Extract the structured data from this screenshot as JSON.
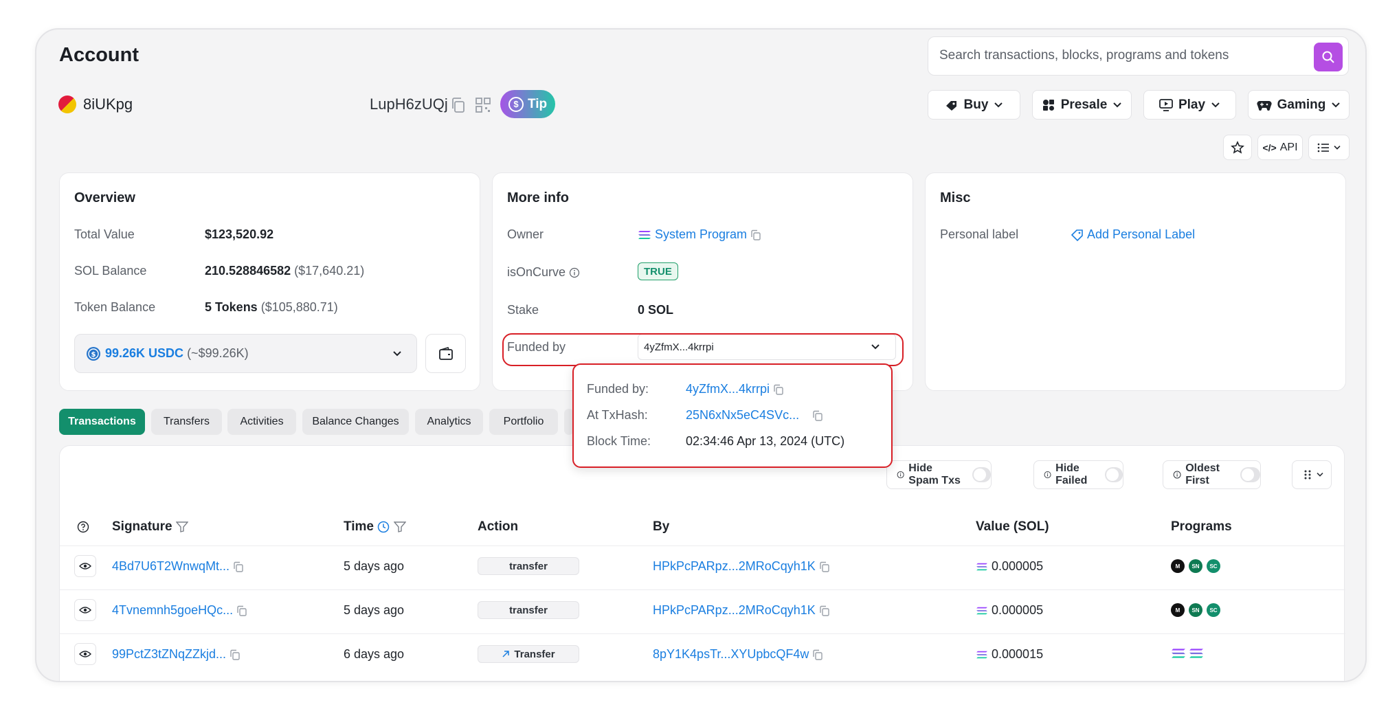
{
  "header": {
    "title": "Account",
    "search_placeholder": "Search transactions, blocks, programs and tokens"
  },
  "account": {
    "name": "8iUKpg",
    "address_short": "LupH6zUQj",
    "tip_label": "Tip"
  },
  "menu": {
    "buy": "Buy",
    "presale": "Presale",
    "play": "Play",
    "gaming": "Gaming",
    "api": "API"
  },
  "overview": {
    "title": "Overview",
    "total_value_label": "Total Value",
    "total_value": "$123,520.92",
    "sol_balance_label": "SOL Balance",
    "sol_balance": "210.528846582",
    "sol_balance_usd": "($17,640.21)",
    "token_balance_label": "Token Balance",
    "token_balance": "5 Tokens",
    "token_balance_usd": "($105,880.71)",
    "token_select_value": "99.26K USDC",
    "token_select_usd": "(~$99.26K)"
  },
  "more_info": {
    "title": "More info",
    "owner_label": "Owner",
    "owner_value": "System Program",
    "oncurve_label": "isOnCurve",
    "oncurve_value": "TRUE",
    "stake_label": "Stake",
    "stake_value": "0 SOL",
    "funded_label": "Funded by",
    "funded_value": "4yZfmX...4krrpi"
  },
  "misc": {
    "title": "Misc",
    "personal_label": "Personal label",
    "add_label": "Add Personal Label"
  },
  "popup": {
    "funded_by_label": "Funded by:",
    "funded_by_value": "4yZfmX...4krrpi",
    "tx_label": "At TxHash:",
    "tx_value": "25N6xNx5eC4SVc...",
    "time_label": "Block Time:",
    "time_value": "02:34:46 Apr 13, 2024 (UTC)"
  },
  "tabs": [
    "Transactions",
    "Transfers",
    "Activities",
    "Balance Changes",
    "Analytics",
    "Portfolio"
  ],
  "filters": {
    "spam": "Hide Spam Txs",
    "failed": "Hide Failed",
    "oldest": "Oldest First"
  },
  "table": {
    "headers": {
      "signature": "Signature",
      "time": "Time",
      "action": "Action",
      "by": "By",
      "value": "Value (SOL)",
      "programs": "Programs"
    },
    "rows": [
      {
        "signature": "4Bd7U6T2WnwqMt...",
        "time": "5 days ago",
        "action": "transfer",
        "by": "HPkPcPARpz...2MRoCqyh1K",
        "value": "0.000005"
      },
      {
        "signature": "4Tvnemnh5goeHQc...",
        "time": "5 days ago",
        "action": "transfer",
        "by": "HPkPcPARpz...2MRoCqyh1K",
        "value": "0.000005"
      },
      {
        "signature": "99PctZ3tZNqZZkjd...",
        "time": "6 days ago",
        "action": "Transfer",
        "by": "8pY1K4psTr...XYUpbcQF4w",
        "value": "0.000015"
      }
    ]
  },
  "colors": {
    "accent_green": "#138f6c",
    "link_blue": "#1a7ee0",
    "search_button": "#b54ee3",
    "highlight_red": "#d81f26"
  }
}
